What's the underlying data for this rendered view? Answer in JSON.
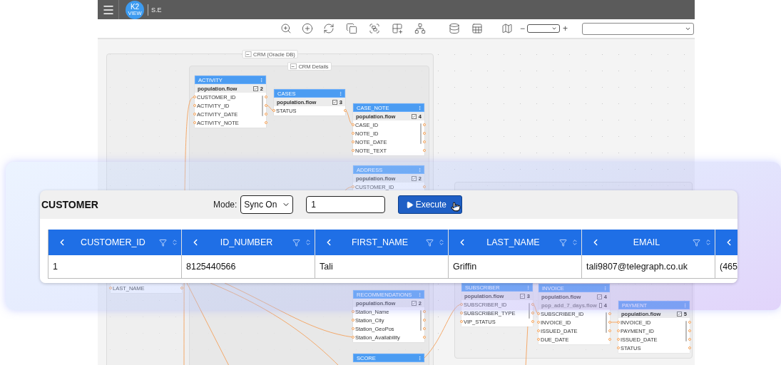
{
  "app_bar": {
    "logo": "K2",
    "logo_sub": "VIEW",
    "title": "S.E"
  },
  "toolbar": {
    "zoom_minus": "−",
    "zoom_plus": "+"
  },
  "canvas": {
    "groups": [
      {
        "title": "CRM (Oracle DB)",
        "toggle": "−"
      },
      {
        "title": "CRM Details",
        "toggle": "−"
      }
    ],
    "nodes": [
      {
        "title": "ACTIVITY",
        "flows": [
          {
            "name": "population.flow",
            "checked": true,
            "count": "2"
          }
        ],
        "fields": [
          "CUSTOMER_ID",
          "ACTIVITY_ID",
          "ACTIVITY_DATE",
          "ACTIVITY_NOTE"
        ]
      },
      {
        "title": "CASES",
        "flows": [
          {
            "name": "population.flow",
            "checked": true,
            "count": "3"
          }
        ],
        "fields": [
          "STATUS"
        ]
      },
      {
        "title": "CASE_NOTE",
        "flows": [
          {
            "name": "population.flow",
            "checked": true,
            "count": "4"
          }
        ],
        "fields": [
          "CASE_ID",
          "NOTE_ID",
          "NOTE_DATE",
          "NOTE_TEXT"
        ]
      },
      {
        "title": "ADDRESS",
        "flows": [
          {
            "name": "population.flow",
            "checked": true,
            "count": "2"
          }
        ],
        "fields": [
          "CUSTOMER_ID"
        ]
      },
      {
        "fields": [
          "LAST_NAME"
        ]
      },
      {
        "title": "RECOMMENDATIONS",
        "flows": [
          {
            "name": "population.flow",
            "checked": true,
            "count": "2"
          }
        ],
        "fields": [
          "Station_Name",
          "Station_City",
          "Station_GeoPos",
          "Station_Availability"
        ]
      },
      {
        "title": "SCORE"
      },
      {
        "title": "SUBSCRIBER",
        "flows": [
          {
            "name": "population.flow",
            "checked": true,
            "count": "3"
          }
        ],
        "fields": [
          "SUBSCRIBER_ID",
          "SUBSCRIBER_TYPE",
          "VIP_STATUS"
        ]
      },
      {
        "title": "INVOICE",
        "flows": [
          {
            "name": "population.flow",
            "checked": true,
            "count": "4"
          },
          {
            "name": "pop_add_7_days.flow",
            "checked": false,
            "count": "4"
          }
        ],
        "fields": [
          "SUBSCRIBER_ID",
          "INVOICE_ID",
          "ISSUED_DATE",
          "DUE_DATE"
        ]
      },
      {
        "title": "PAYMENT",
        "flows": [
          {
            "name": "population.flow",
            "checked": true,
            "count": "5"
          }
        ],
        "fields": [
          "INVOICE_ID",
          "PAYMENT_ID",
          "ISSUED_DATE",
          "STATUS"
        ]
      }
    ]
  },
  "panel": {
    "title": "CUSTOMER",
    "mode_label": "Mode:",
    "mode_value": "Sync On",
    "input_value": "1",
    "execute": "Execute",
    "table": {
      "columns": [
        "CUSTOMER_ID",
        "ID_NUMBER",
        "FIRST_NAME",
        "LAST_NAME",
        "EMAIL"
      ],
      "rows": [
        [
          "1",
          "8125440566",
          "Tali",
          "Griffin",
          "tali9807@telegraph.co.uk",
          "(465"
        ]
      ]
    }
  }
}
